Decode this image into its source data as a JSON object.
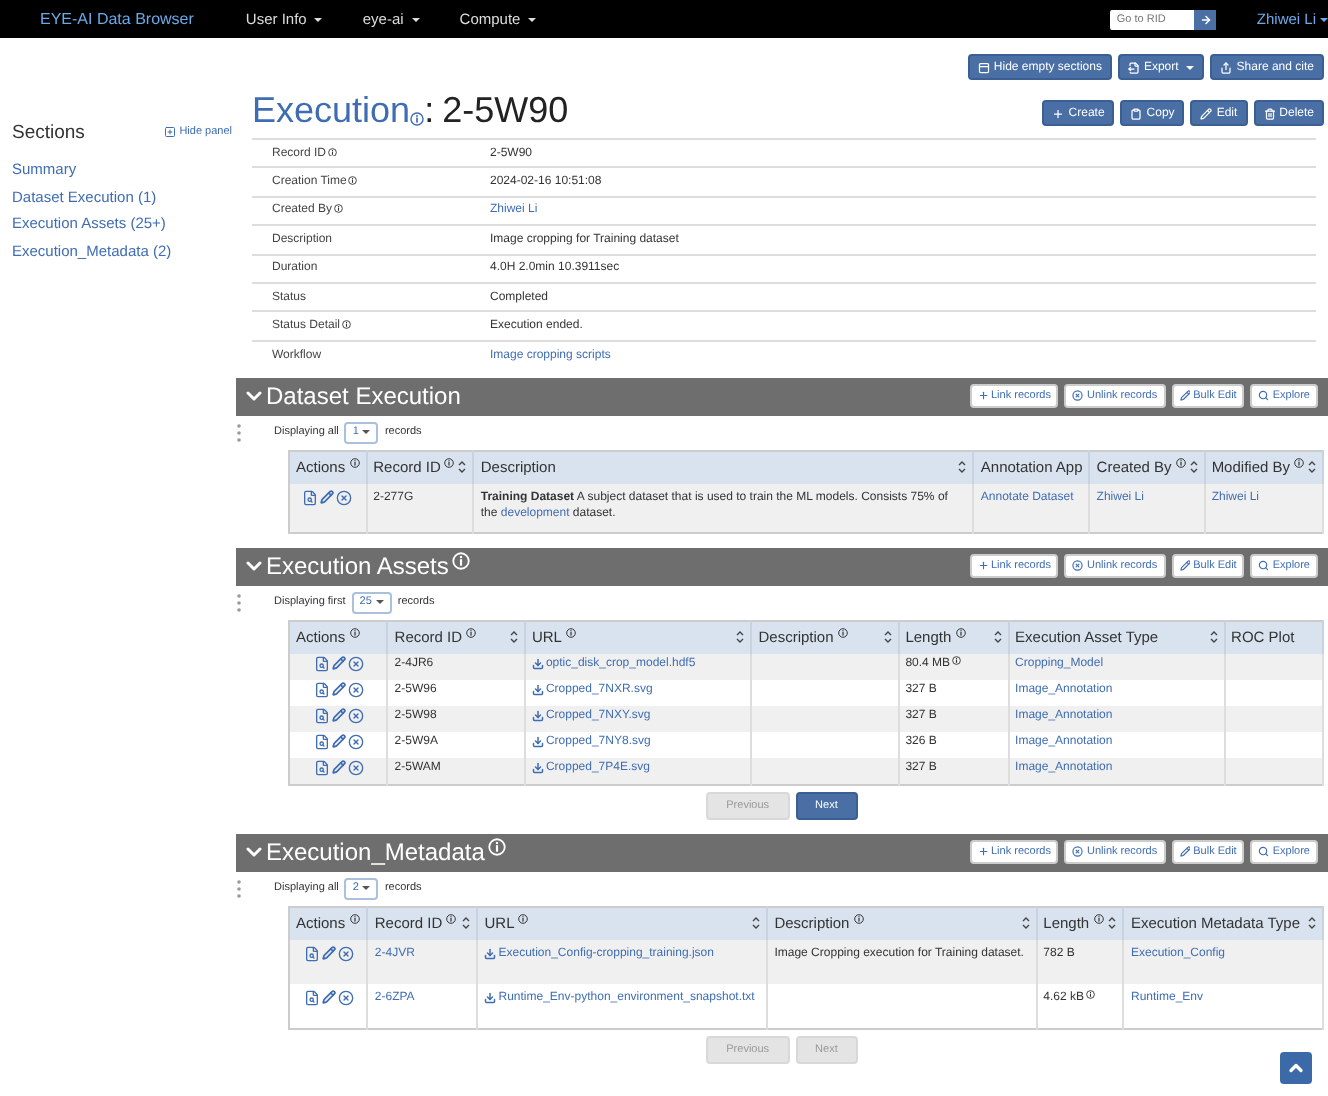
{
  "navbar": {
    "brand": "EYE-AI Data Browser",
    "menus": [
      {
        "label": "User Info"
      },
      {
        "label": "eye-ai"
      },
      {
        "label": "Compute"
      }
    ],
    "goto_placeholder": "Go to RID",
    "user": "Zhiwei Li"
  },
  "top_actions": [
    {
      "label": "Hide empty sections",
      "kind": "hide"
    },
    {
      "label": "Export",
      "kind": "export"
    },
    {
      "label": "Share and cite",
      "kind": "share"
    }
  ],
  "sidebar": {
    "title": "Sections",
    "hide_label": "Hide panel",
    "items": [
      {
        "label": "Summary"
      },
      {
        "label": "Dataset Execution (1)"
      },
      {
        "label": "Execution Assets (25+)"
      },
      {
        "label": "Execution_Metadata (2)"
      }
    ]
  },
  "record": {
    "entity": "Execution",
    "separator": ":",
    "rid": "2-5W90",
    "actions": [
      {
        "label": "Create",
        "kind": "create"
      },
      {
        "label": "Copy",
        "kind": "copy"
      },
      {
        "label": "Edit",
        "kind": "edit"
      },
      {
        "label": "Delete",
        "kind": "delete"
      }
    ],
    "fields": [
      {
        "label": "Record ID",
        "info": true,
        "value": "2-5W90",
        "link": false
      },
      {
        "label": "Creation Time",
        "info": true,
        "value": "2024-02-16 10:51:08",
        "link": false
      },
      {
        "label": "Created By",
        "info": true,
        "value": "Zhiwei Li",
        "link": true
      },
      {
        "label": "Description",
        "info": false,
        "value": "Image cropping for Training dataset",
        "link": false
      },
      {
        "label": "Duration",
        "info": false,
        "value": "4.0H 2.0min 10.3911sec",
        "link": false
      },
      {
        "label": "Status",
        "info": false,
        "value": "Completed",
        "link": false
      },
      {
        "label": "Status Detail",
        "info": true,
        "value": "Execution ended.",
        "link": false
      },
      {
        "label": "Workflow",
        "info": false,
        "value": "Image cropping scripts",
        "link": true
      }
    ]
  },
  "sections": [
    {
      "title": "Dataset Execution",
      "info": false,
      "actions": [
        {
          "label": "Link records",
          "kind": "link"
        },
        {
          "label": "Unlink records",
          "kind": "unlink"
        },
        {
          "label": "Bulk Edit",
          "kind": "edit"
        },
        {
          "label": "Explore",
          "kind": "explore"
        }
      ],
      "display_prefix": "Displaying all",
      "page_size": "1",
      "display_suffix": "records",
      "columns": [
        {
          "label": "Actions",
          "info": true,
          "sortable": false
        },
        {
          "label": "Record ID",
          "info": true,
          "sortable": true
        },
        {
          "label": "Description",
          "info": false,
          "sortable": true
        },
        {
          "label": "Annotation App",
          "info": false,
          "sortable": false
        },
        {
          "label": "Created By",
          "info": true,
          "sortable": true
        },
        {
          "label": "Modified By",
          "info": true,
          "sortable": true
        }
      ],
      "rows": [
        [
          {
            "kind": "actions"
          },
          {
            "kind": "text",
            "text": "2-277G"
          },
          {
            "kind": "rich",
            "segments": [
              {
                "text": "**Training Dataset** A subject dataset that is used to train the ML models. Consists 75% of the ",
                "link": false
              },
              {
                "text": "development",
                "link": true
              },
              {
                "text": " dataset.",
                "link": false
              }
            ]
          },
          {
            "kind": "link",
            "text": "Annotate Dataset"
          },
          {
            "kind": "link",
            "text": "Zhiwei Li"
          },
          {
            "kind": "link",
            "text": "Zhiwei Li"
          }
        ]
      ]
    },
    {
      "title": "Execution Assets",
      "info": true,
      "actions": [
        {
          "label": "Link records",
          "kind": "link"
        },
        {
          "label": "Unlink records",
          "kind": "unlink"
        },
        {
          "label": "Bulk Edit",
          "kind": "edit"
        },
        {
          "label": "Explore",
          "kind": "explore"
        }
      ],
      "display_prefix": "Displaying first",
      "page_size": "25",
      "display_suffix": "records",
      "columns": [
        {
          "label": "Actions",
          "info": true,
          "sortable": false
        },
        {
          "label": "Record ID",
          "info": true,
          "sortable": true
        },
        {
          "label": "URL",
          "info": true,
          "sortable": true
        },
        {
          "label": "Description",
          "info": true,
          "sortable": true
        },
        {
          "label": "Length",
          "info": true,
          "sortable": true
        },
        {
          "label": "Execution Asset Type",
          "info": false,
          "sortable": true
        },
        {
          "label": "ROC Plot",
          "info": false,
          "sortable": false
        }
      ],
      "rows": [
        [
          {
            "kind": "actions"
          },
          {
            "kind": "text",
            "text": "2-4JR6"
          },
          {
            "kind": "file",
            "text": "optic_disk_crop_model.hdf5"
          },
          {
            "kind": "empty"
          },
          {
            "kind": "text",
            "text": "80.4 MB",
            "info": true
          },
          {
            "kind": "link",
            "text": "Cropping_Model"
          },
          {
            "kind": "empty"
          }
        ],
        [
          {
            "kind": "actions"
          },
          {
            "kind": "text",
            "text": "2-5W96"
          },
          {
            "kind": "file",
            "text": "Cropped_7NXR.svg"
          },
          {
            "kind": "empty"
          },
          {
            "kind": "text",
            "text": "327 B"
          },
          {
            "kind": "link",
            "text": "Image_Annotation"
          },
          {
            "kind": "empty"
          }
        ],
        [
          {
            "kind": "actions"
          },
          {
            "kind": "text",
            "text": "2-5W98"
          },
          {
            "kind": "file",
            "text": "Cropped_7NXY.svg"
          },
          {
            "kind": "empty"
          },
          {
            "kind": "text",
            "text": "327 B"
          },
          {
            "kind": "link",
            "text": "Image_Annotation"
          },
          {
            "kind": "empty"
          }
        ],
        [
          {
            "kind": "actions"
          },
          {
            "kind": "text",
            "text": "2-5W9A"
          },
          {
            "kind": "file",
            "text": "Cropped_7NY8.svg"
          },
          {
            "kind": "empty"
          },
          {
            "kind": "text",
            "text": "326 B"
          },
          {
            "kind": "link",
            "text": "Image_Annotation"
          },
          {
            "kind": "empty"
          }
        ],
        [
          {
            "kind": "actions"
          },
          {
            "kind": "text",
            "text": "2-5WAM"
          },
          {
            "kind": "file",
            "text": "Cropped_7P4E.svg"
          },
          {
            "kind": "empty"
          },
          {
            "kind": "text",
            "text": "327 B"
          },
          {
            "kind": "link",
            "text": "Image_Annotation"
          },
          {
            "kind": "empty"
          }
        ]
      ],
      "pager": [
        {
          "label": "Previous",
          "disabled": true
        },
        {
          "label": "Next",
          "disabled": false
        }
      ]
    },
    {
      "title": "Execution_Metadata",
      "info": true,
      "actions": [
        {
          "label": "Link records",
          "kind": "link"
        },
        {
          "label": "Unlink records",
          "kind": "unlink"
        },
        {
          "label": "Bulk Edit",
          "kind": "edit"
        },
        {
          "label": "Explore",
          "kind": "explore"
        }
      ],
      "display_prefix": "Displaying all",
      "page_size": "2",
      "display_suffix": "records",
      "columns": [
        {
          "label": "Actions",
          "info": true,
          "sortable": false
        },
        {
          "label": "Record ID",
          "info": true,
          "sortable": true
        },
        {
          "label": "URL",
          "info": true,
          "sortable": true
        },
        {
          "label": "Description",
          "info": true,
          "sortable": true
        },
        {
          "label": "Length",
          "info": true,
          "sortable": true
        },
        {
          "label": "Execution Metadata Type",
          "info": false,
          "sortable": true
        }
      ],
      "rows": [
        [
          {
            "kind": "actions"
          },
          {
            "kind": "link",
            "text": "2-4JVR"
          },
          {
            "kind": "file",
            "text": "Execution_Config-cropping_training.json"
          },
          {
            "kind": "text",
            "text": "Image Cropping execution for Training dataset."
          },
          {
            "kind": "text",
            "text": "782 B"
          },
          {
            "kind": "link",
            "text": "Execution_Config"
          }
        ],
        [
          {
            "kind": "actions"
          },
          {
            "kind": "link",
            "text": "2-6ZPA"
          },
          {
            "kind": "file",
            "text": "Runtime_Env-python_environment_snapshot.txt"
          },
          {
            "kind": "empty"
          },
          {
            "kind": "text",
            "text": "4.62 kB",
            "info": true
          },
          {
            "kind": "link",
            "text": "Runtime_Env"
          }
        ]
      ],
      "pager": [
        {
          "label": "Previous",
          "disabled": true
        },
        {
          "label": "Next",
          "disabled": true
        }
      ]
    }
  ]
}
